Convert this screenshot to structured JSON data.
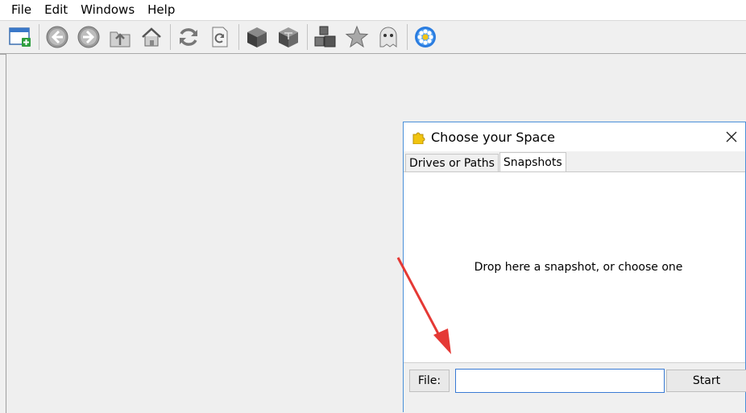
{
  "menu": {
    "file": "File",
    "edit": "Edit",
    "windows": "Windows",
    "help": "Help"
  },
  "toolbar": {
    "buttons": [
      "new-window-icon",
      "back-icon",
      "forward-icon",
      "up-folder-icon",
      "home-icon",
      "refresh-icon",
      "reload-page-icon",
      "cube-dark-icon",
      "cube-open-icon",
      "cubes-icon",
      "star-icon",
      "ghost-icon",
      "flower-settings-icon"
    ]
  },
  "dialog": {
    "title": "Choose your Space",
    "tabs": [
      "Drives or Paths",
      "Snapshots"
    ],
    "active_tab": "Snapshots",
    "drop_text": "Drop here a snapshot, or choose one",
    "file_label": "File:",
    "file_value": "",
    "start_label": "Start"
  },
  "colors": {
    "accent": "#4a90d9",
    "annotation_arrow": "#e53935"
  }
}
